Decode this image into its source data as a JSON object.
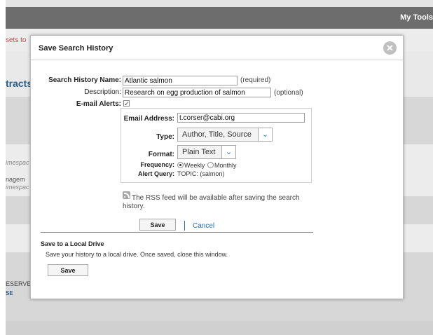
{
  "background": {
    "top_nav_label": "My Tools",
    "left_snippets": {
      "sets": "sets to",
      "tracts": "tracts",
      "mespace1": "imespac",
      "management": "nagem",
      "mespace2": "imespac",
      "reserved": "ESERVE",
      "se": "SE"
    }
  },
  "dialog": {
    "title": "Save Search History",
    "close_icon": "close-icon",
    "fields": {
      "name_label": "Search History Name:",
      "name_value": "Atlantic salmon",
      "name_hint": "(required)",
      "description_label": "Description:",
      "description_value": "Research on egg production of salmon",
      "description_hint": "(optional)",
      "email_alerts_label": "E-mail Alerts:",
      "email_alerts_checked": true
    },
    "email_options": {
      "address_label": "Email Address:",
      "address_value": "t.corser@cabi.org",
      "type_label": "Type:",
      "type_selected": "Author, Title, Source",
      "format_label": "Format:",
      "format_selected": "Plain Text",
      "frequency_label": "Frequency:",
      "frequency_options": [
        "Weekly",
        "Monthly"
      ],
      "frequency_selected": "Weekly",
      "alert_query_label": "Alert Query:",
      "alert_query_value": "TOPIC: (salmon)"
    },
    "rss_note": "The RSS feed will be available after saving the search history.",
    "actions": {
      "save_label": "Save",
      "cancel_label": "Cancel"
    },
    "local_drive": {
      "title": "Save to a Local Drive",
      "description": "Save your history to a local drive. Once saved, close this window.",
      "save_label": "Save"
    }
  },
  "colors": {
    "link": "#2a6db5",
    "top_bar": "#6d6d6d",
    "overlay_background": "#e5e5e5"
  }
}
